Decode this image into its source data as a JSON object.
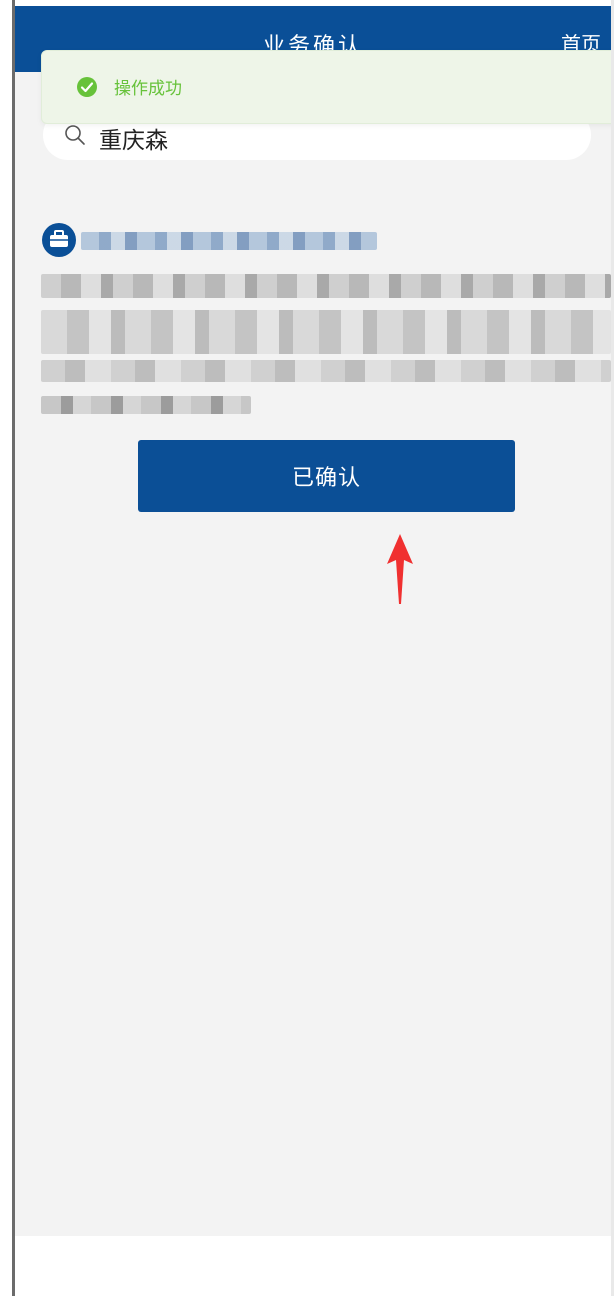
{
  "header": {
    "title": "业务确认",
    "home_label": "首页"
  },
  "toast": {
    "message": "操作成功",
    "icon": "check-circle-icon",
    "color": "#67c23a"
  },
  "search": {
    "value": "重庆森",
    "icon": "search-icon"
  },
  "card": {
    "icon": "briefcase-icon"
  },
  "confirm_button": {
    "label": "已确认"
  },
  "colors": {
    "primary": "#0a4f97",
    "background": "#f3f3f3",
    "annotation_arrow": "#f03030"
  }
}
